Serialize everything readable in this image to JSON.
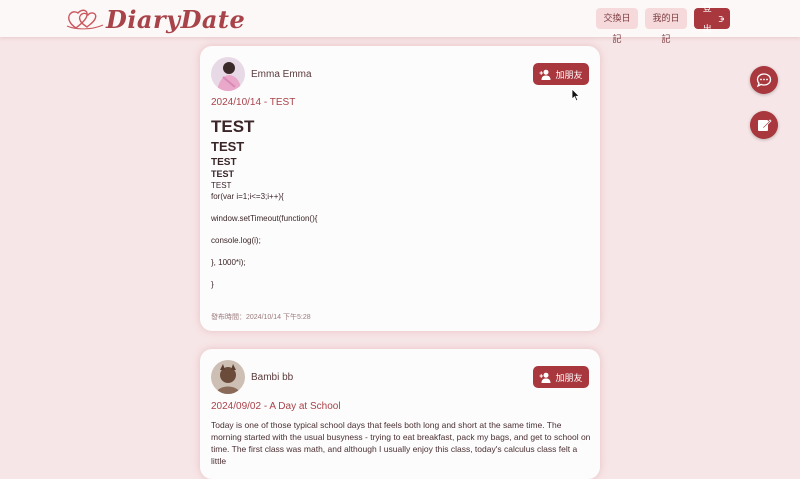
{
  "app": {
    "name": "DiaryDate"
  },
  "nav": {
    "exchange": "交換日記",
    "my_diary": "我的日記",
    "logout": "登出"
  },
  "colors": {
    "accent": "#a8373e",
    "background": "#f7e6e7",
    "card": "#fdfcfc"
  },
  "posts": [
    {
      "author": "Emma Emma",
      "add_friend": "加朋友",
      "title": "2024/10/14 - TEST",
      "lines": {
        "h1": "TEST",
        "h2": "TEST",
        "h3": "TEST",
        "h4": "TEST",
        "p1": "TEST",
        "code1": "for(var i=1;i<=3;i++){",
        "code2": "window.setTimeout(function(){",
        "code3": "console.log(i);",
        "code4": "}, 1000*i);",
        "code5": "}"
      },
      "published": "發布時間：2024/10/14 下午5:28"
    },
    {
      "author": "Bambi bb",
      "add_friend": "加朋友",
      "title": "2024/09/02 - A Day at School",
      "paragraph": "Today is one of those typical school days that feels both long and short at the same time. The morning started with the usual busyness - trying to eat breakfast, pack my bags, and get to school on time. The first class was math, and although I usually enjoy this class, today's calculus class felt a little"
    }
  ],
  "icons": {
    "chat": "chat-bubble-icon",
    "write": "edit-note-icon",
    "add_user": "add-user-icon",
    "logout": "logout-icon"
  }
}
